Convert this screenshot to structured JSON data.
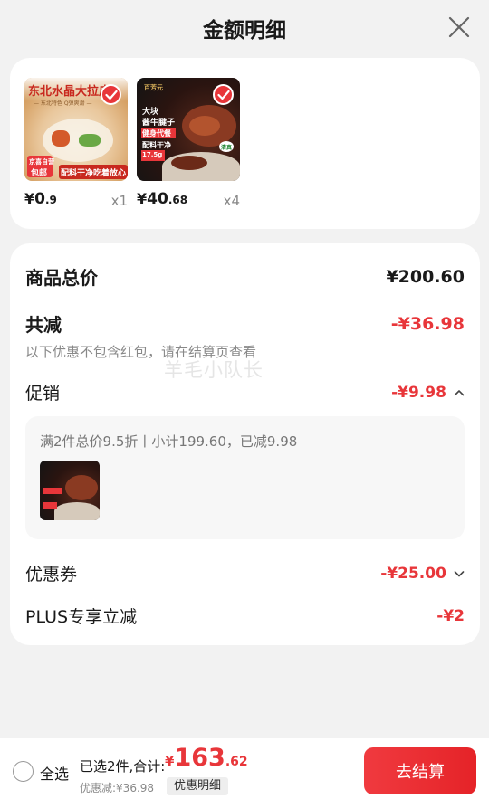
{
  "header": {
    "title": "金额明细"
  },
  "products": [
    {
      "image_text_top": "东北水晶大拉皮",
      "image_text_sub": "— 东北特色 Q弹爽滑 —",
      "image_badge_1": "京喜自营",
      "image_badge_2": "包邮",
      "image_text_bottom": "配料干净吃着放心",
      "price_symbol": "¥",
      "price_int": "0",
      "price_dec": ".9",
      "qty": "x1",
      "checked": true
    },
    {
      "image_brand": "百芳元",
      "image_line_1": "大块",
      "image_line_2": "酱牛腱子",
      "image_tag_1": "健身代餐",
      "image_tag_2": "配料干净",
      "image_weight": "17.5g",
      "image_badge": "清真",
      "price_symbol": "¥",
      "price_int": "40",
      "price_dec": ".68",
      "qty": "x4",
      "checked": true
    }
  ],
  "detail": {
    "subtotal_label": "商品总价",
    "subtotal_value": "¥200.60",
    "discount_label": "共减",
    "discount_value": "-¥36.98",
    "note": "以下优惠不包含红包，请在结算页查看",
    "watermark": "羊毛小队长",
    "promo_label": "促销",
    "promo_value": "-¥9.98",
    "promo_desc": "满2件总价9.5折丨小计199.60，已减9.98",
    "coupon_label": "优惠券",
    "coupon_value": "-¥25.00",
    "plus_label": "PLUS专享立减",
    "plus_value": "-¥2"
  },
  "bottom": {
    "select_all": "全选",
    "summary": "已选2件,合计:",
    "total_symbol": "¥",
    "total_int": "163",
    "total_dec": ".62",
    "saved": "优惠减:¥36.98",
    "detail_tag": "优惠明细",
    "checkout": "去结算"
  },
  "colors": {
    "accent": "#e8363a",
    "muted": "#888888"
  },
  "icons": [
    "close-icon",
    "check-icon",
    "chevron-up-icon",
    "chevron-down-icon",
    "radio-icon"
  ]
}
